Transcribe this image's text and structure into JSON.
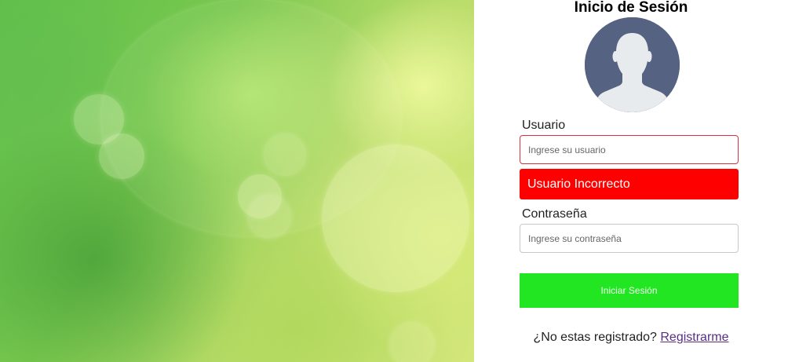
{
  "login": {
    "title": "Inicio de Sesión",
    "avatar_icon": "user-avatar-icon",
    "username": {
      "label": "Usuario",
      "placeholder": "Ingrese su usuario",
      "value": ""
    },
    "error_message": "Usuario Incorrecto",
    "password": {
      "label": "Contraseña",
      "placeholder": "Ingrese su contraseña",
      "value": ""
    },
    "submit_label": "Iniciar Sesión",
    "footer_text": "¿No estas registrado?",
    "register_link": "Registrarme"
  },
  "colors": {
    "error": "#ff0000",
    "error_border": "#d9323f",
    "submit": "#22e622",
    "avatar_bg": "#556282",
    "link": "#5a2d82"
  }
}
